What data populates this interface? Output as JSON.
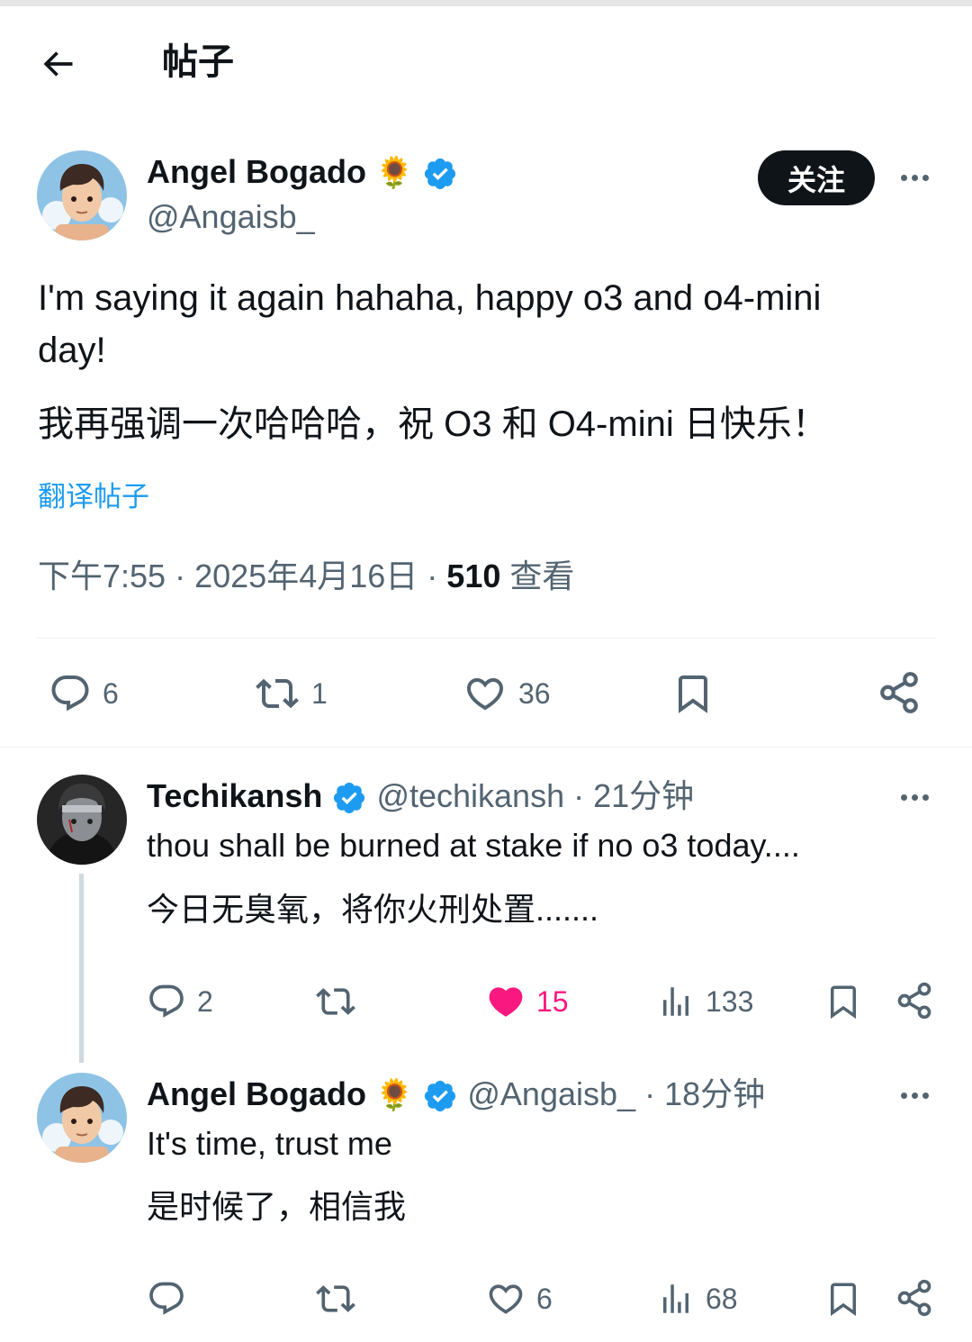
{
  "header": {
    "title": "帖子"
  },
  "post": {
    "author_name": "Angel Bogado",
    "author_emoji": "🌻",
    "author_handle": "@Angaisb_",
    "follow_label": "关注",
    "text_en_line1": "I'm saying it again hahaha, happy o3 and o4-mini",
    "text_en_line2": "day!",
    "text_zh": "我再强调一次哈哈哈，祝 O3 和 O4-mini 日快乐！",
    "translate_label": "翻译帖子",
    "time": "下午7:55",
    "date": "2025年4月16日",
    "views_count": "510",
    "views_label": "查看",
    "meta_separator": "·",
    "stats": {
      "replies": "6",
      "reposts": "1",
      "likes": "36"
    }
  },
  "replies": [
    {
      "author_name": "Techikansh",
      "author_handle": "@techikansh",
      "age": "21分钟",
      "separator": "·",
      "text_en": "thou shall be burned at stake if no o3 today....",
      "text_zh": "今日无臭氧，将你火刑处置.......",
      "stats": {
        "replies": "2",
        "reposts": "",
        "likes": "15",
        "liked": true,
        "views": "133"
      }
    },
    {
      "author_name": "Angel Bogado",
      "author_emoji": "🌻",
      "author_handle": "@Angaisb_",
      "age": "18分钟",
      "separator": "·",
      "text_en": "It's time, trust me",
      "text_zh": "是时候了，相信我",
      "stats": {
        "replies": "",
        "reposts": "",
        "likes": "6",
        "liked": false,
        "views": "68"
      }
    }
  ],
  "colors": {
    "text": "#0f1419",
    "secondary": "#536471",
    "accent_blue": "#1d9bf0",
    "like_pink": "#f91880",
    "divider": "#eff3f4"
  }
}
